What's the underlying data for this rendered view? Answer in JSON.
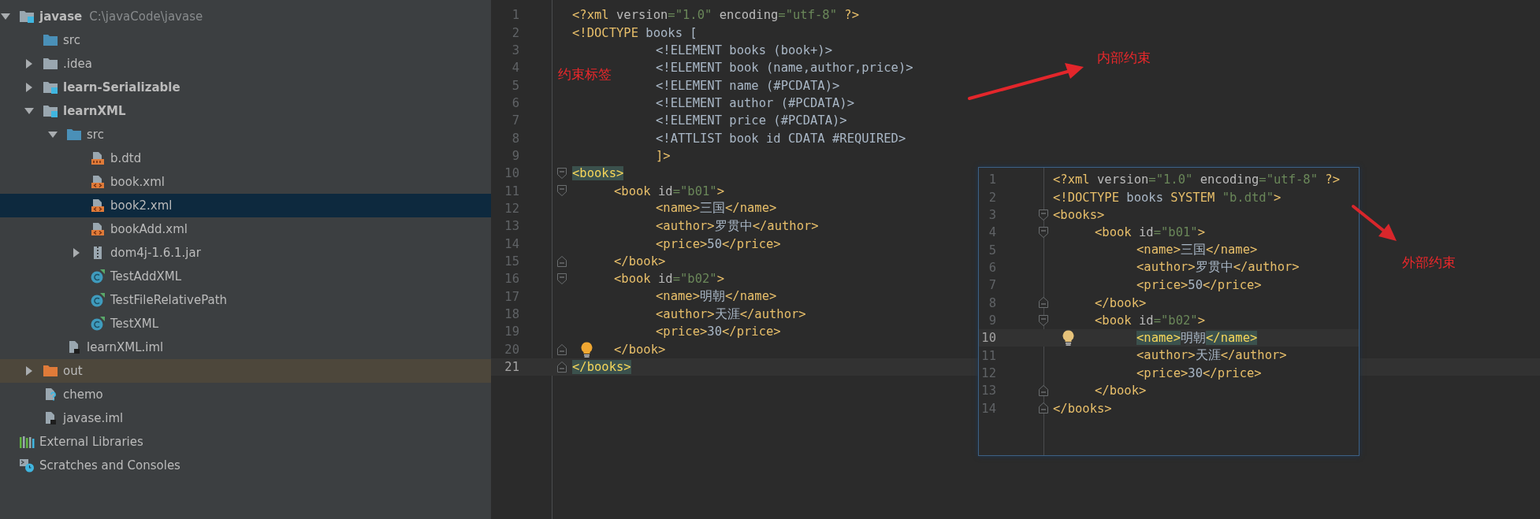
{
  "project_tree": [
    {
      "label": "javase",
      "hint": "C:\\javaCode\\javase",
      "kind": "module",
      "expanded": true,
      "selected": false,
      "children": [
        {
          "label": "src",
          "kind": "src-folder",
          "selected": false
        },
        {
          "label": ".idea",
          "kind": "folder",
          "expanded": false,
          "selected": false
        },
        {
          "label": "learn-Serializable",
          "kind": "module",
          "expanded": false,
          "selected": false
        },
        {
          "label": "learnXML",
          "kind": "module",
          "expanded": true,
          "selected": false,
          "children": [
            {
              "label": "src",
              "kind": "src-folder",
              "expanded": true,
              "selected": false,
              "children": [
                {
                  "label": "b.dtd",
                  "kind": "dtd",
                  "selected": false
                },
                {
                  "label": "book.xml",
                  "kind": "xml",
                  "selected": false
                },
                {
                  "label": "book2.xml",
                  "kind": "xml",
                  "selected": true
                },
                {
                  "label": "bookAdd.xml",
                  "kind": "xml",
                  "selected": false
                },
                {
                  "label": "dom4j-1.6.1.jar",
                  "kind": "jar",
                  "expanded": false,
                  "selected": false
                },
                {
                  "label": "TestAddXML",
                  "kind": "class",
                  "selected": false
                },
                {
                  "label": "TestFileRelativePath",
                  "kind": "class",
                  "selected": false
                },
                {
                  "label": "TestXML",
                  "kind": "class",
                  "selected": false
                }
              ]
            },
            {
              "label": "learnXML.iml",
              "kind": "iml",
              "selected": false
            }
          ]
        },
        {
          "label": "out",
          "kind": "excluded-folder",
          "expanded": false,
          "selected": false
        },
        {
          "label": "chemo",
          "kind": "unknown",
          "selected": false
        },
        {
          "label": "javase.iml",
          "kind": "iml",
          "selected": false
        }
      ]
    },
    {
      "label": "External Libraries",
      "kind": "libraries",
      "selected": false
    },
    {
      "label": "Scratches and Consoles",
      "kind": "scratches",
      "selected": false
    }
  ],
  "editor": {
    "lines": [
      {
        "number": "1",
        "kind": "plain",
        "bulb": false,
        "current": false,
        "tokens": [
          {
            "text": "<?xml",
            "kind": "tag"
          },
          {
            "text": " version",
            "kind": "attr"
          },
          {
            "text": "=\"1.0\"",
            "kind": "value"
          },
          {
            "text": " encoding",
            "kind": "attr"
          },
          {
            "text": "=\"utf-8\"",
            "kind": "value"
          },
          {
            "text": " ?>",
            "kind": "tag"
          }
        ]
      },
      {
        "number": "2",
        "kind": "plain",
        "bulb": false,
        "current": false,
        "tokens": [
          {
            "text": "<!DOCTYPE",
            "kind": "tag"
          },
          {
            "text": " books [",
            "kind": "text"
          }
        ]
      },
      {
        "number": "3",
        "kind": "plain",
        "bulb": false,
        "current": false,
        "tokens": [
          {
            "text": "\t\t<!ELEMENT books (book+)>",
            "kind": "text"
          }
        ]
      },
      {
        "number": "4",
        "kind": "plain",
        "bulb": false,
        "current": false,
        "tokens": [
          {
            "text": "\t\t<!ELEMENT book (name,author,price)>",
            "kind": "text"
          }
        ]
      },
      {
        "number": "5",
        "kind": "plain",
        "bulb": false,
        "current": false,
        "tokens": [
          {
            "text": "\t\t<!ELEMENT name (#PCDATA)>",
            "kind": "text"
          }
        ]
      },
      {
        "number": "6",
        "kind": "plain",
        "bulb": false,
        "current": false,
        "tokens": [
          {
            "text": "\t\t<!ELEMENT author (#PCDATA)>",
            "kind": "text"
          }
        ]
      },
      {
        "number": "7",
        "kind": "plain",
        "bulb": false,
        "current": false,
        "tokens": [
          {
            "text": "\t\t<!ELEMENT price (#PCDATA)>",
            "kind": "text"
          }
        ]
      },
      {
        "number": "8",
        "kind": "plain",
        "bulb": false,
        "current": false,
        "tokens": [
          {
            "text": "\t\t<!ATTLIST book id CDATA #REQUIRED>",
            "kind": "text"
          }
        ]
      },
      {
        "number": "9",
        "kind": "plain",
        "bulb": false,
        "current": false,
        "tokens": [
          {
            "text": "\t\t]>",
            "kind": "tag"
          }
        ]
      },
      {
        "number": "10",
        "kind": "fold-start",
        "bulb": false,
        "current": false,
        "tokens": [
          {
            "text": "<books>",
            "kind": "matched-tag"
          }
        ]
      },
      {
        "number": "11",
        "kind": "fold-start",
        "bulb": false,
        "current": false,
        "tokens": [
          {
            "text": "\t<book",
            "kind": "tag"
          },
          {
            "text": " id",
            "kind": "attr"
          },
          {
            "text": "=\"b01\"",
            "kind": "value"
          },
          {
            "text": ">",
            "kind": "tag"
          }
        ]
      },
      {
        "number": "12",
        "kind": "plain",
        "bulb": false,
        "current": false,
        "tokens": [
          {
            "text": "\t\t<name>",
            "kind": "tag"
          },
          {
            "text": "三国",
            "kind": "text"
          },
          {
            "text": "</name>",
            "kind": "tag"
          }
        ]
      },
      {
        "number": "13",
        "kind": "plain",
        "bulb": false,
        "current": false,
        "tokens": [
          {
            "text": "\t\t<author>",
            "kind": "tag"
          },
          {
            "text": "罗贯中",
            "kind": "text"
          },
          {
            "text": "</author>",
            "kind": "tag"
          }
        ]
      },
      {
        "number": "14",
        "kind": "plain",
        "bulb": false,
        "current": false,
        "tokens": [
          {
            "text": "\t\t<price>",
            "kind": "tag"
          },
          {
            "text": "50",
            "kind": "text"
          },
          {
            "text": "</price>",
            "kind": "tag"
          }
        ]
      },
      {
        "number": "15",
        "kind": "fold-end",
        "bulb": false,
        "current": false,
        "tokens": [
          {
            "text": "\t</book>",
            "kind": "tag"
          }
        ]
      },
      {
        "number": "16",
        "kind": "fold-start",
        "bulb": false,
        "current": false,
        "tokens": [
          {
            "text": "\t<book",
            "kind": "tag"
          },
          {
            "text": " id",
            "kind": "attr"
          },
          {
            "text": "=\"b02\"",
            "kind": "value"
          },
          {
            "text": ">",
            "kind": "tag"
          }
        ]
      },
      {
        "number": "17",
        "kind": "plain",
        "bulb": false,
        "current": false,
        "tokens": [
          {
            "text": "\t\t<name>",
            "kind": "tag"
          },
          {
            "text": "明朝",
            "kind": "text"
          },
          {
            "text": "</name>",
            "kind": "tag"
          }
        ]
      },
      {
        "number": "18",
        "kind": "plain",
        "bulb": false,
        "current": false,
        "tokens": [
          {
            "text": "\t\t<author>",
            "kind": "tag"
          },
          {
            "text": "天涯",
            "kind": "text"
          },
          {
            "text": "</author>",
            "kind": "tag"
          }
        ]
      },
      {
        "number": "19",
        "kind": "plain",
        "bulb": false,
        "current": false,
        "tokens": [
          {
            "text": "\t\t<price>",
            "kind": "tag"
          },
          {
            "text": "30",
            "kind": "text"
          },
          {
            "text": "</price>",
            "kind": "tag"
          }
        ]
      },
      {
        "number": "20",
        "kind": "fold-end",
        "bulb": true,
        "current": false,
        "tokens": [
          {
            "text": "\t</book>",
            "kind": "tag"
          }
        ]
      },
      {
        "number": "21",
        "kind": "fold-end",
        "bulb": false,
        "current": true,
        "tokens": [
          {
            "text": "</books>",
            "kind": "matched-tag"
          }
        ]
      }
    ]
  },
  "popup_editor": {
    "lines": [
      {
        "number": "1",
        "kind": "plain",
        "bulb": false,
        "current": false,
        "tokens": [
          {
            "text": "<?xml",
            "kind": "tag"
          },
          {
            "text": " version",
            "kind": "attr"
          },
          {
            "text": "=\"1.0\"",
            "kind": "value"
          },
          {
            "text": " encoding",
            "kind": "attr"
          },
          {
            "text": "=\"utf-8\"",
            "kind": "value"
          },
          {
            "text": " ?>",
            "kind": "tag"
          }
        ]
      },
      {
        "number": "2",
        "kind": "plain",
        "bulb": false,
        "current": false,
        "tokens": [
          {
            "text": "<!DOCTYPE",
            "kind": "tag"
          },
          {
            "text": " books ",
            "kind": "text"
          },
          {
            "text": "SYSTEM",
            "kind": "tag"
          },
          {
            "text": " \"b.dtd\"",
            "kind": "value"
          },
          {
            "text": ">",
            "kind": "tag"
          }
        ]
      },
      {
        "number": "3",
        "kind": "fold-start",
        "bulb": false,
        "current": false,
        "tokens": [
          {
            "text": "<books>",
            "kind": "tag"
          }
        ]
      },
      {
        "number": "4",
        "kind": "fold-start",
        "bulb": false,
        "current": false,
        "tokens": [
          {
            "text": "\t<book",
            "kind": "tag"
          },
          {
            "text": " id",
            "kind": "attr"
          },
          {
            "text": "=\"b01\"",
            "kind": "value"
          },
          {
            "text": ">",
            "kind": "tag"
          }
        ]
      },
      {
        "number": "5",
        "kind": "plain",
        "bulb": false,
        "current": false,
        "tokens": [
          {
            "text": "\t\t<name>",
            "kind": "tag"
          },
          {
            "text": "三国",
            "kind": "text"
          },
          {
            "text": "</name>",
            "kind": "tag"
          }
        ]
      },
      {
        "number": "6",
        "kind": "plain",
        "bulb": false,
        "current": false,
        "tokens": [
          {
            "text": "\t\t<author>",
            "kind": "tag"
          },
          {
            "text": "罗贯中",
            "kind": "text"
          },
          {
            "text": "</author>",
            "kind": "tag"
          }
        ]
      },
      {
        "number": "7",
        "kind": "plain",
        "bulb": false,
        "current": false,
        "tokens": [
          {
            "text": "\t\t<price>",
            "kind": "tag"
          },
          {
            "text": "50",
            "kind": "text"
          },
          {
            "text": "</price>",
            "kind": "tag"
          }
        ]
      },
      {
        "number": "8",
        "kind": "fold-end",
        "bulb": false,
        "current": false,
        "tokens": [
          {
            "text": "\t</book>",
            "kind": "tag"
          }
        ]
      },
      {
        "number": "9",
        "kind": "fold-start",
        "bulb": false,
        "current": false,
        "tokens": [
          {
            "text": "\t<book",
            "kind": "tag"
          },
          {
            "text": " id",
            "kind": "attr"
          },
          {
            "text": "=\"b02\"",
            "kind": "value"
          },
          {
            "text": ">",
            "kind": "tag"
          }
        ]
      },
      {
        "number": "10",
        "kind": "plain",
        "bulb": true,
        "current": true,
        "tokens": [
          {
            "text": "\t\t<name>",
            "kind": "matched-tag"
          },
          {
            "text": "明朝",
            "kind": "text"
          },
          {
            "text": "</name>",
            "kind": "matched-tag"
          }
        ]
      },
      {
        "number": "11",
        "kind": "plain",
        "bulb": false,
        "current": false,
        "tokens": [
          {
            "text": "\t\t<author>",
            "kind": "tag"
          },
          {
            "text": "天涯",
            "kind": "text"
          },
          {
            "text": "</author>",
            "kind": "tag"
          }
        ]
      },
      {
        "number": "12",
        "kind": "plain",
        "bulb": false,
        "current": false,
        "tokens": [
          {
            "text": "\t\t<price>",
            "kind": "tag"
          },
          {
            "text": "30",
            "kind": "text"
          },
          {
            "text": "</price>",
            "kind": "tag"
          }
        ]
      },
      {
        "number": "13",
        "kind": "fold-end",
        "bulb": false,
        "current": false,
        "tokens": [
          {
            "text": "\t</book>",
            "kind": "tag"
          }
        ]
      },
      {
        "number": "14",
        "kind": "fold-end",
        "bulb": false,
        "current": false,
        "tokens": [
          {
            "text": "</books>",
            "kind": "tag"
          }
        ]
      }
    ]
  },
  "annotations": [
    {
      "text": "约束标签"
    },
    {
      "text": "内部约束"
    },
    {
      "text": "外部约束"
    }
  ]
}
